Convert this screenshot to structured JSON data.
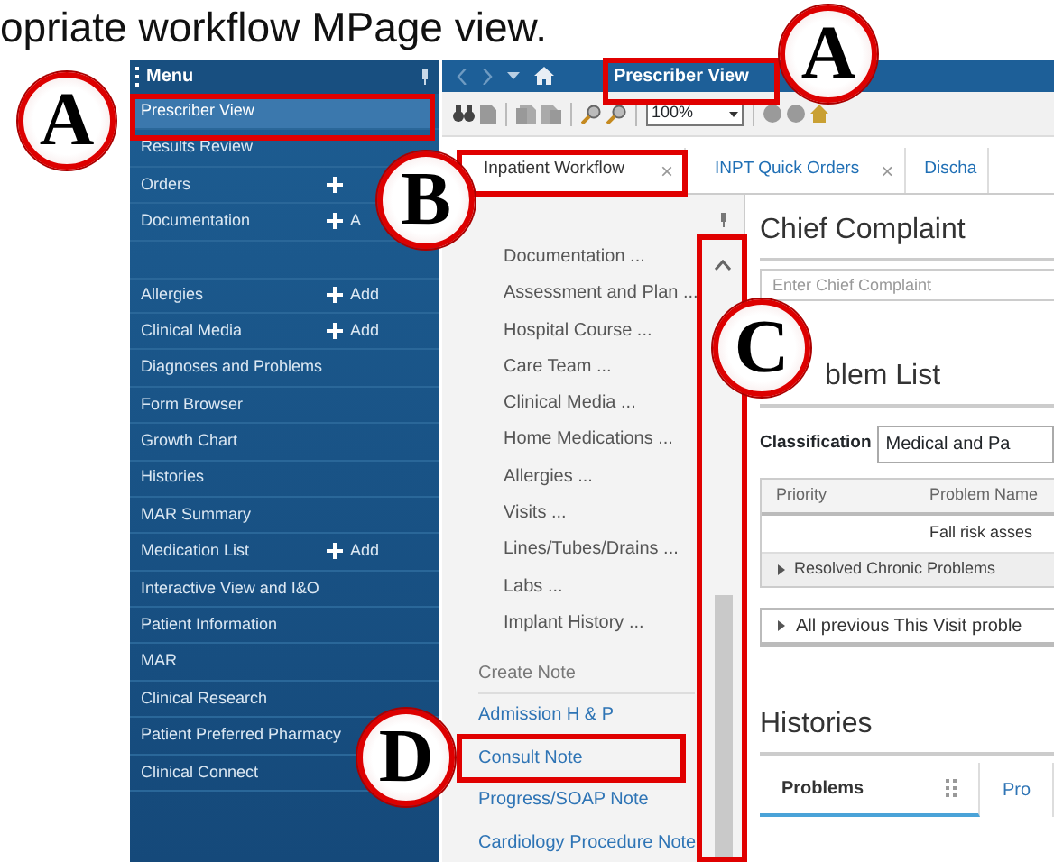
{
  "caption": "opriate workflow MPage view.",
  "menu": {
    "title": "Menu",
    "groups": [
      [
        {
          "label": "Prescriber View",
          "selected": true
        },
        {
          "label": "Results Review",
          "selected": false
        },
        {
          "label": "Orders",
          "selected": false,
          "plus": true
        },
        {
          "label": "Documentation",
          "selected": false,
          "plus": true,
          "add": "A"
        }
      ],
      [
        {
          "label": "Allergies",
          "selected": false,
          "plus": true,
          "add": "Add"
        },
        {
          "label": "Clinical Media",
          "selected": false,
          "plus": true,
          "add": "Add"
        },
        {
          "label": "Diagnoses and Problems",
          "selected": false
        },
        {
          "label": "Form Browser",
          "selected": false
        },
        {
          "label": "Growth Chart",
          "selected": false
        },
        {
          "label": "Histories",
          "selected": false
        },
        {
          "label": "MAR Summary",
          "selected": false
        },
        {
          "label": "Medication List",
          "selected": false,
          "plus": true,
          "add": "Add"
        },
        {
          "label": "Interactive View and I&O",
          "selected": false
        },
        {
          "label": "Patient Information",
          "selected": false
        },
        {
          "label": "MAR",
          "selected": false
        },
        {
          "label": "Clinical Research",
          "selected": false
        },
        {
          "label": "Patient Preferred Pharmacy",
          "selected": false
        },
        {
          "label": "Clinical Connect",
          "selected": false
        }
      ]
    ]
  },
  "view_title": "Prescriber View",
  "zoom": "100%",
  "tabs": [
    {
      "label": "Inpatient Workflow",
      "selected": true,
      "close": "×"
    },
    {
      "label": "INPT Quick Orders",
      "selected": false,
      "close": "×"
    },
    {
      "label": "Discha",
      "selected": false
    }
  ],
  "workflow_nav": {
    "sections": [
      "Documentation ...",
      "Assessment and Plan ...",
      "Hospital Course ...",
      "Care Team ...",
      "Clinical Media ...",
      "Home Medications ...",
      "Allergies ...",
      "Visits ...",
      "Lines/Tubes/Drains ...",
      "Labs ...",
      "Implant History ..."
    ],
    "create_note": {
      "title": "Create Note",
      "links": [
        "Admission H & P",
        "Consult Note",
        "Progress/SOAP Note",
        "Cardiology Procedure Note"
      ]
    }
  },
  "chief_complaint": {
    "title": "Chief Complaint",
    "placeholder": "Enter Chief Complaint"
  },
  "problem_list": {
    "title": "blem List",
    "classification_label": "Classification",
    "classification_value": "Medical and Pa",
    "columns": [
      "Priority",
      "Problem Name"
    ],
    "rows": [
      {
        "column_2": "Fall risk asses"
      }
    ],
    "groups": [
      {
        "label": "Resolved Chronic Problems",
        "expanded": false
      }
    ],
    "previous": {
      "label": "All previous This Visit proble",
      "expanded": false
    }
  },
  "histories": {
    "title": "Histories",
    "tabs": [
      {
        "label": "Problems",
        "selected": true
      },
      {
        "label": "Pro",
        "selected": false
      }
    ]
  },
  "callouts": [
    {
      "letter": "A"
    },
    {
      "letter": "A"
    },
    {
      "letter": "B"
    },
    {
      "letter": "C"
    },
    {
      "letter": "D"
    }
  ]
}
